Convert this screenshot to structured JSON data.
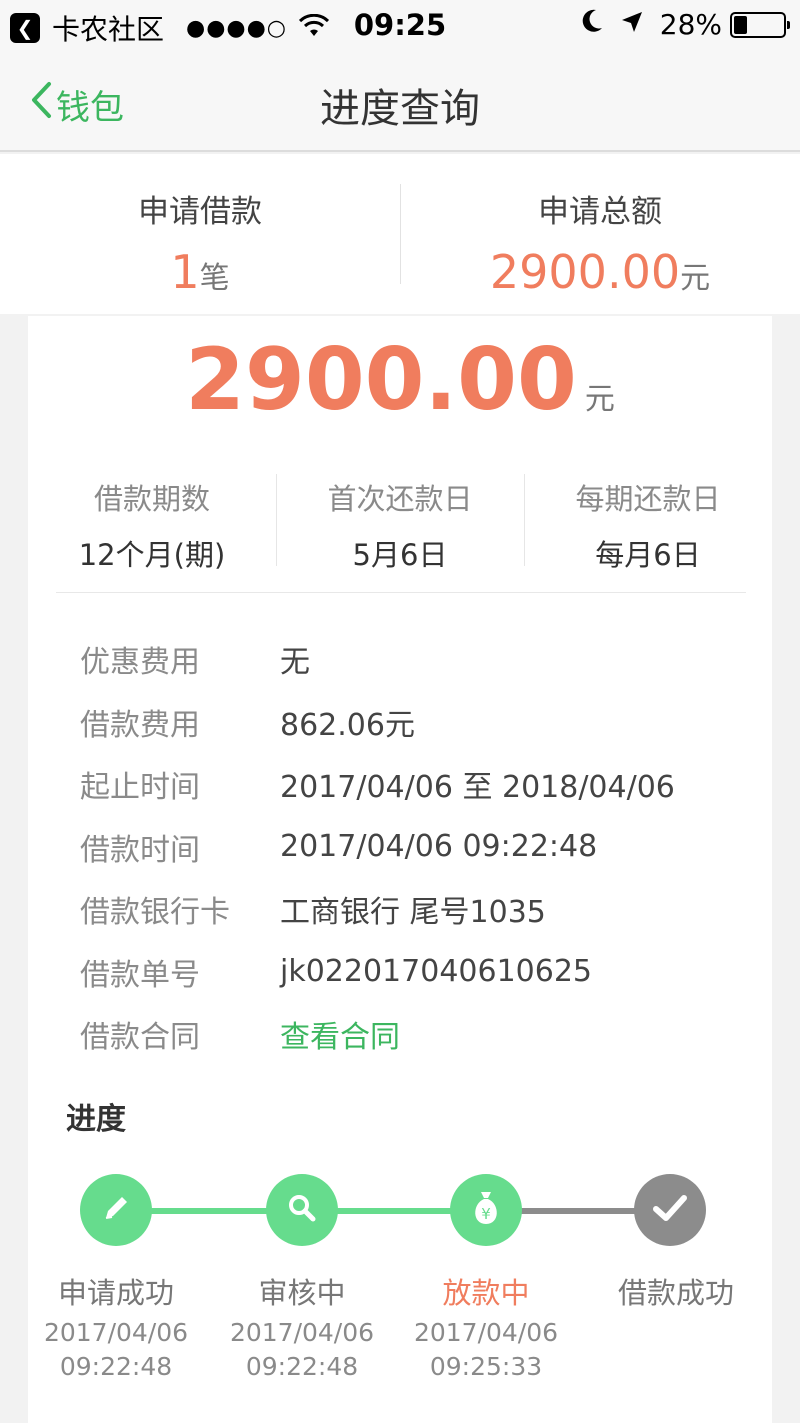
{
  "status_bar": {
    "app_back": "卡农社区",
    "signal": "●●●●○",
    "time": "09:25",
    "battery": "28%",
    "battery_level": 0.28
  },
  "nav": {
    "back_label": "钱包",
    "title": "进度查询"
  },
  "summary": {
    "count_label": "申请借款",
    "count_value": "1",
    "count_unit": "笔",
    "total_label": "申请总额",
    "total_value": "2900.00",
    "total_unit": "元"
  },
  "loan": {
    "amount": "2900.00",
    "amount_unit": "元",
    "terms": [
      {
        "label": "借款期数",
        "value": "12个月(期)"
      },
      {
        "label": "首次还款日",
        "value": "5月6日"
      },
      {
        "label": "每期还款日",
        "value": "每月6日"
      }
    ],
    "details": [
      {
        "label": "优惠费用",
        "value": "无"
      },
      {
        "label": "借款费用",
        "value": "862.06元"
      },
      {
        "label": "起止时间",
        "value": "2017/04/06 至 2018/04/06"
      },
      {
        "label": "借款时间",
        "value": "2017/04/06 09:22:48"
      },
      {
        "label": "借款银行卡",
        "value": "工商银行 尾号1035"
      },
      {
        "label": "借款单号",
        "value": "jk022017040610625"
      }
    ],
    "contract_label": "借款合同",
    "contract_link": "查看合同"
  },
  "progress": {
    "title": "进度",
    "steps": [
      {
        "label": "申请成功",
        "date": "2017/04/06",
        "time": "09:22:48",
        "icon": "pencil-icon",
        "state": "done"
      },
      {
        "label": "审核中",
        "date": "2017/04/06",
        "time": "09:22:48",
        "icon": "magnifier-icon",
        "state": "done"
      },
      {
        "label": "放款中",
        "date": "2017/04/06",
        "time": "09:25:33",
        "icon": "money-bag-icon",
        "state": "current"
      },
      {
        "label": "借款成功",
        "date": "",
        "time": "",
        "icon": "checkmark-icon",
        "state": "pending"
      }
    ]
  },
  "colors": {
    "green": "#3cb65f",
    "node_green": "#66dc8d",
    "orange": "#f07d5e",
    "gray": "#8c8c8c"
  }
}
